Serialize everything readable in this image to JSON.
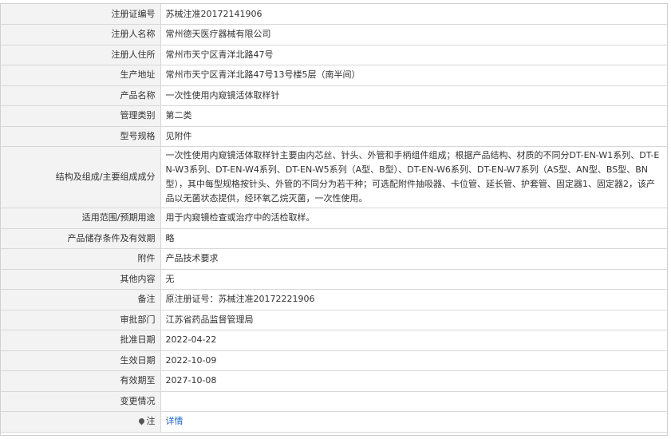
{
  "rows": [
    {
      "label": "注册证编号",
      "value": "苏械注准20172141906"
    },
    {
      "label": "注册人名称",
      "value": "常州德天医疗器械有限公司"
    },
    {
      "label": "注册人住所",
      "value": "常州市天宁区青洋北路47号"
    },
    {
      "label": "生产地址",
      "value": "常州市天宁区青洋北路47号13号楼5层（南半间）"
    },
    {
      "label": "产品名称",
      "value": "一次性使用内窥镜活体取样针"
    },
    {
      "label": "管理类别",
      "value": "第二类"
    },
    {
      "label": "型号规格",
      "value": "见附件"
    },
    {
      "label": "结构及组成/主要组成成分",
      "value": "一次性使用内窥镜活体取样针主要由内芯丝、针头、外管和手柄组件组成；根据产品结构、材质的不同分DT-EN-W1系列、DT-EN-W3系列、DT-EN-W4系列、DT-EN-W5系列（A型、B型）、DT-EN-W6系列、DT-EN-W7系列（AS型、AN型、BS型、BN型），其中每型规格按针头、外管的不同分为若干种；可选配附件抽吸器、卡位管、延长管、护套管、固定器1、固定器2，该产品以无菌状态提供，经环氧乙烷灭菌，一次性使用。"
    },
    {
      "label": "适用范围/预期用途",
      "value": "用于内窥镜检查或治疗中的活检取样。"
    },
    {
      "label": "产品储存条件及有效期",
      "value": "略"
    },
    {
      "label": "附件",
      "value": "产品技术要求"
    },
    {
      "label": "其他内容",
      "value": "无"
    },
    {
      "label": "备注",
      "value": "原注册证号：苏械注准20172221906"
    },
    {
      "label": "审批部门",
      "value": "江苏省药品监督管理局"
    },
    {
      "label": "批准日期",
      "value": "2022-04-22"
    },
    {
      "label": "生效日期",
      "value": "2022-10-09"
    },
    {
      "label": "有效期至",
      "value": "2027-10-08"
    },
    {
      "label": "变更情况",
      "value": ""
    },
    {
      "label": "注",
      "value": "详情",
      "icon": "location-pin-icon"
    }
  ]
}
